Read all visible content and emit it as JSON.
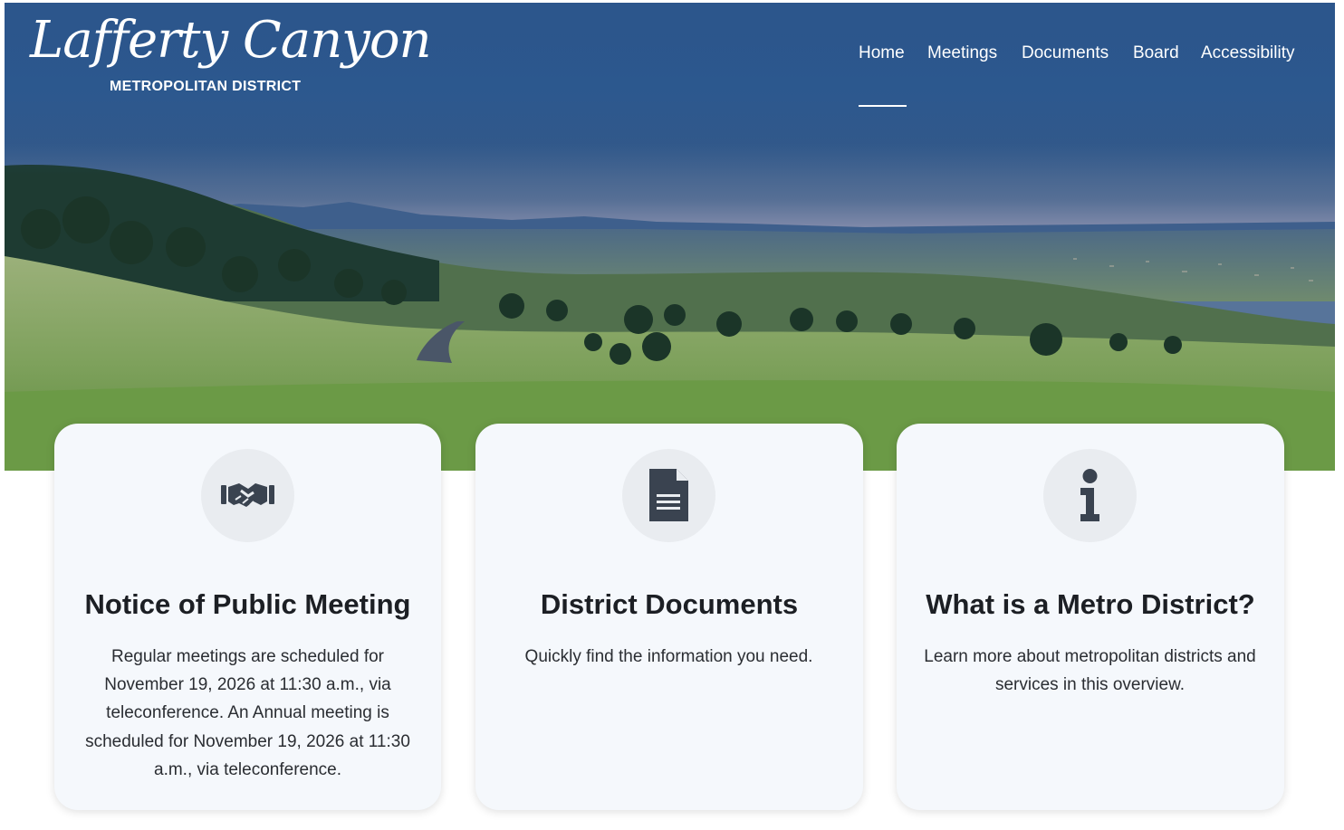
{
  "header": {
    "logo_script": "Lafferty Canyon",
    "logo_subtitle": "METROPOLITAN DISTRICT"
  },
  "nav": {
    "active": "Home",
    "items": [
      "Home",
      "Meetings",
      "Documents",
      "Board",
      "Accessibility"
    ]
  },
  "cards": [
    {
      "icon": "handshake-icon",
      "title": "Notice of Public Meeting",
      "text": "Regular meetings are scheduled for November 19, 2026 at 11:30 a.m., via teleconference. An Annual meeting is scheduled for November 19, 2026 at 11:30 a.m., via teleconference."
    },
    {
      "icon": "document-icon",
      "title": "District Documents",
      "text": "Quickly find the information you need."
    },
    {
      "icon": "info-icon",
      "title": "What is a Metro District?",
      "text": "Learn more about metropolitan districts and services in this overview."
    }
  ],
  "colors": {
    "header_blue": "#27558d",
    "card_bg": "#f5f8fc",
    "icon_color": "#3a4350",
    "title_color": "#1c1f24"
  }
}
